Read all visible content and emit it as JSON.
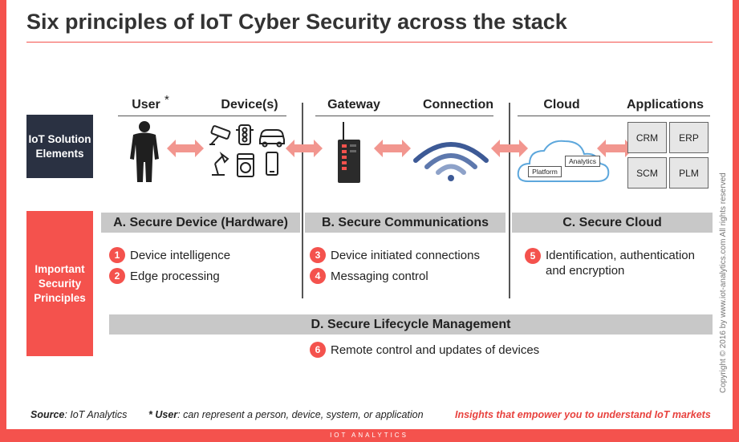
{
  "title": "Six principles of IoT Cyber Security across the stack",
  "columns": {
    "user": "User",
    "asterisk": "*",
    "devices": "Device(s)",
    "gateway": "Gateway",
    "connection": "Connection",
    "cloud": "Cloud",
    "applications": "Applications"
  },
  "labels": {
    "iot_solution_elements": "IoT Solution Elements",
    "important_principles": "Important Security Principles"
  },
  "cloud_labels": {
    "platform": "Platform",
    "analytics": "Analytics"
  },
  "apps": [
    "CRM",
    "ERP",
    "SCM",
    "PLM"
  ],
  "sections": {
    "a": "A. Secure Device (Hardware)",
    "b": "B. Secure Communications",
    "c": "C. Secure Cloud",
    "d": "D. Secure Lifecycle Management"
  },
  "principles": [
    {
      "num": "1",
      "text": "Device intelligence"
    },
    {
      "num": "2",
      "text": "Edge processing"
    },
    {
      "num": "3",
      "text": "Device initiated connections"
    },
    {
      "num": "4",
      "text": "Messaging control"
    },
    {
      "num": "5",
      "text": "Identification, authentication and encryption"
    },
    {
      "num": "6",
      "text": "Remote control and updates of devices"
    }
  ],
  "footer": {
    "source_label": "Source",
    "source_text": ": IoT Analytics",
    "user_note_label": "* User",
    "user_note_text": ": can represent a person, device, system, or application",
    "tagline": "Insights that empower you to understand IoT markets",
    "brand": "IOT ANALYTICS"
  },
  "copyright": "Copyright © 2016 by www.iot-analytics.com All rights reserved",
  "colors": {
    "accent": "#f4524d",
    "dark_label": "#2a3142",
    "bar_gray": "#c8c8c8",
    "wifi_blue": "#3d5a96"
  }
}
